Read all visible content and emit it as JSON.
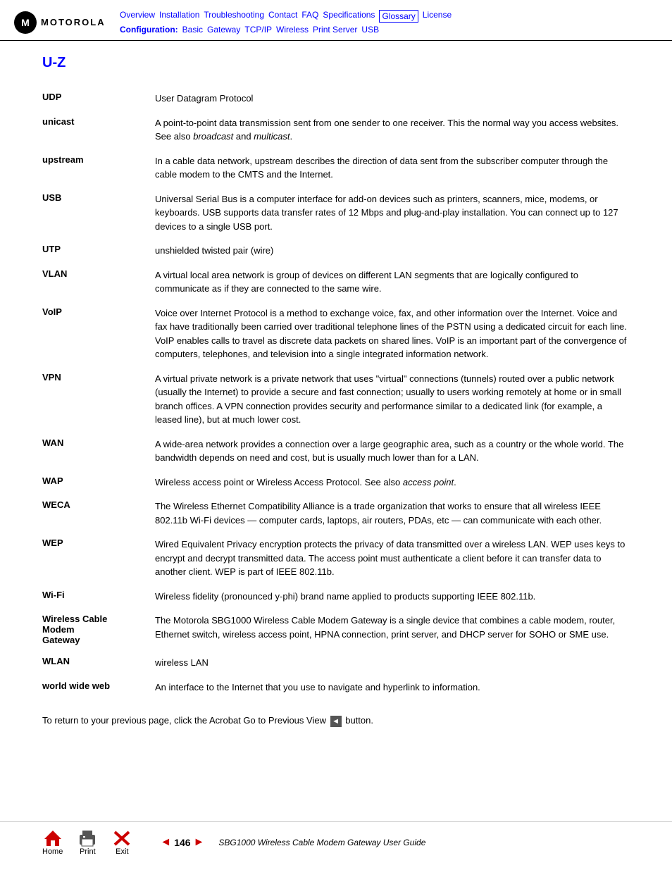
{
  "header": {
    "logo_text": "MOTOROLA",
    "nav_top": [
      {
        "label": "Overview",
        "active": false
      },
      {
        "label": "Installation",
        "active": false
      },
      {
        "label": "Troubleshooting",
        "active": false
      },
      {
        "label": "Contact",
        "active": false
      },
      {
        "label": "FAQ",
        "active": false
      },
      {
        "label": "Specifications",
        "active": false
      },
      {
        "label": "Glossary",
        "active": true
      },
      {
        "label": "License",
        "active": false
      }
    ],
    "nav_bottom_label": "Configuration:",
    "nav_bottom": [
      {
        "label": "Basic"
      },
      {
        "label": "Gateway"
      },
      {
        "label": "TCP/IP"
      },
      {
        "label": "Wireless"
      },
      {
        "label": "Print Server"
      },
      {
        "label": "USB"
      }
    ]
  },
  "page": {
    "title": "U-Z"
  },
  "glossary": [
    {
      "term": "UDP",
      "definition": "User Datagram Protocol"
    },
    {
      "term": "unicast",
      "definition": "A point-to-point data transmission sent from one sender to one receiver. This the normal way you access websites. See also broadcast and multicast."
    },
    {
      "term": "upstream",
      "definition": "In a cable data network, upstream describes the direction of data sent from the subscriber computer through the cable modem to the CMTS and the Internet."
    },
    {
      "term": "USB",
      "definition": "Universal Serial Bus is a computer interface for add-on devices such as printers, scanners, mice, modems, or keyboards. USB supports data transfer rates of 12 Mbps and plug-and-play installation. You can connect up to 127 devices to a single USB port."
    },
    {
      "term": "UTP",
      "definition": "unshielded twisted pair (wire)"
    },
    {
      "term": "VLAN",
      "definition": "A virtual local area network is group of devices on different LAN segments that are logically configured to communicate as if they are connected to the same wire."
    },
    {
      "term": "VoIP",
      "definition": "Voice over Internet Protocol is a method to exchange voice, fax, and other information over the Internet. Voice and fax have traditionally been carried over traditional telephone lines of the PSTN using a dedicated circuit for each line. VoIP enables calls to travel as discrete data packets on shared lines. VoIP is an important part of the convergence of computers, telephones, and television into a single integrated information network."
    },
    {
      "term": "VPN",
      "definition": "A virtual private network is a private network that uses \"virtual\" connections (tunnels) routed over a public network (usually the Internet) to provide a secure and fast connection; usually to users working remotely at home or in small branch offices. A VPN connection provides security and performance similar to a dedicated link (for example, a leased line), but at much lower cost."
    },
    {
      "term": "WAN",
      "definition": "A wide-area network provides a connection over a large geographic area, such as a country or the whole world. The bandwidth depends on need and cost, but is usually much lower than for a LAN."
    },
    {
      "term": "WAP",
      "definition": "Wireless access point or Wireless Access Protocol. See also access point."
    },
    {
      "term": "WECA",
      "definition": "The Wireless Ethernet Compatibility Alliance is a trade organization that works to ensure that all wireless IEEE 802.11b Wi-Fi devices — computer cards, laptops, air routers, PDAs, etc — can communicate with each other."
    },
    {
      "term": "WEP",
      "definition": "Wired Equivalent Privacy encryption protects the privacy of data transmitted over a wireless LAN. WEP uses keys to encrypt and decrypt transmitted data. The access point must authenticate a client before it can transfer data to another client. WEP is part of IEEE 802.11b."
    },
    {
      "term": "Wi-Fi",
      "definition": "Wireless fidelity (pronounced y-phi) brand name applied to products supporting IEEE 802.11b."
    },
    {
      "term": "Wireless Cable\nModem\nGateway",
      "definition": "The Motorola SBG1000 Wireless Cable Modem Gateway is a single device that combines a cable modem, router, Ethernet switch, wireless access point, HPNA connection, print server, and DHCP server for SOHO or SME use."
    },
    {
      "term": "WLAN",
      "definition": "wireless LAN"
    },
    {
      "term": "world wide web",
      "definition": "An interface to the Internet that you use to navigate and hyperlink to information."
    }
  ],
  "prev_page_note": "To return to your previous page, click the Acrobat Go to Previous View",
  "prev_page_note2": "button.",
  "footer": {
    "home_label": "Home",
    "print_label": "Print",
    "exit_label": "Exit",
    "page_number": "146",
    "doc_title": "SBG1000 Wireless Cable Modem Gateway User Guide"
  }
}
